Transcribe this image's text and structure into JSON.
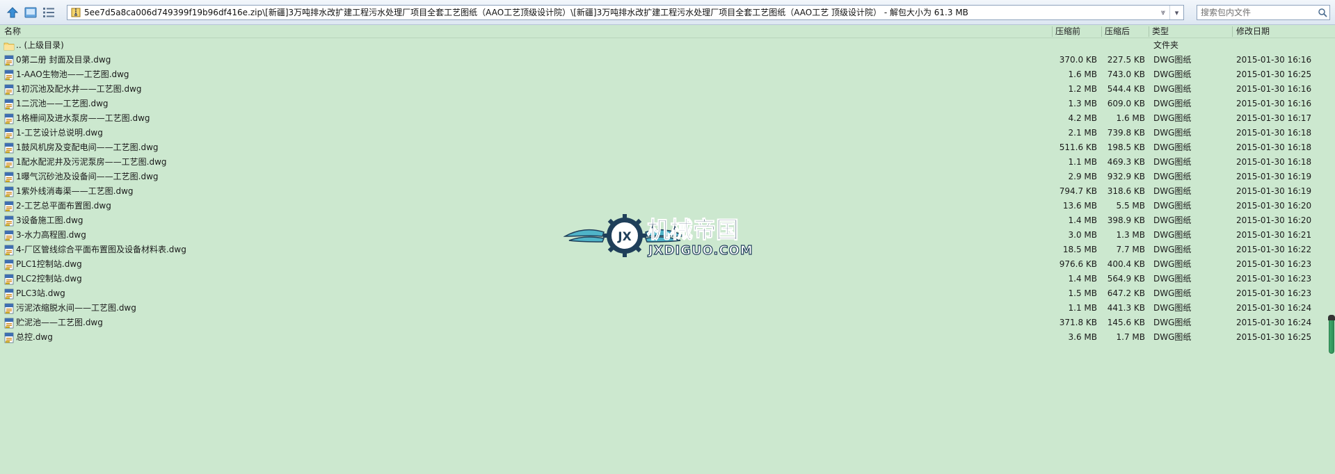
{
  "toolbar": {
    "address": "5ee7d5a8ca006d749399f19b96df416e.zip\\[新疆]3万吨排水改扩建工程污水处理厂项目全套工艺图纸（AAO工艺顶级设计院）\\[新疆]3万吨排水改扩建工程污水处理厂项目全套工艺图纸（AAO工艺 顶级设计院） - 解包大小为 61.3 MB",
    "search_placeholder": "搜索包内文件",
    "addr_history_glyph": "⩔",
    "addr_drop_glyph": "▾"
  },
  "columns": {
    "name": "名称",
    "packed": "压缩前",
    "unpacked": "压缩后",
    "type": "类型",
    "date": "修改日期"
  },
  "parent_row": {
    "name": ".. (上级目录)",
    "type": "文件夹"
  },
  "files": [
    {
      "name": "0第二册 封面及目录.dwg",
      "packed": "370.0 KB",
      "unpacked": "227.5 KB",
      "type": "DWG图纸",
      "date": "2015-01-30 16:16"
    },
    {
      "name": "1-AAO生物池——工艺图.dwg",
      "packed": "1.6 MB",
      "unpacked": "743.0 KB",
      "type": "DWG图纸",
      "date": "2015-01-30 16:25"
    },
    {
      "name": "1初沉池及配水井——工艺图.dwg",
      "packed": "1.2 MB",
      "unpacked": "544.4 KB",
      "type": "DWG图纸",
      "date": "2015-01-30 16:16"
    },
    {
      "name": "1二沉池——工艺图.dwg",
      "packed": "1.3 MB",
      "unpacked": "609.0 KB",
      "type": "DWG图纸",
      "date": "2015-01-30 16:16"
    },
    {
      "name": "1格栅间及进水泵房——工艺图.dwg",
      "packed": "4.2 MB",
      "unpacked": "1.6 MB",
      "type": "DWG图纸",
      "date": "2015-01-30 16:17"
    },
    {
      "name": "1-工艺设计总说明.dwg",
      "packed": "2.1 MB",
      "unpacked": "739.8 KB",
      "type": "DWG图纸",
      "date": "2015-01-30 16:18"
    },
    {
      "name": "1鼓风机房及变配电间——工艺图.dwg",
      "packed": "511.6 KB",
      "unpacked": "198.5 KB",
      "type": "DWG图纸",
      "date": "2015-01-30 16:18"
    },
    {
      "name": "1配水配泥井及污泥泵房——工艺图.dwg",
      "packed": "1.1 MB",
      "unpacked": "469.3 KB",
      "type": "DWG图纸",
      "date": "2015-01-30 16:18"
    },
    {
      "name": "1曝气沉砂池及设备间——工艺图.dwg",
      "packed": "2.9 MB",
      "unpacked": "932.9 KB",
      "type": "DWG图纸",
      "date": "2015-01-30 16:19"
    },
    {
      "name": "1紫外线消毒渠——工艺图.dwg",
      "packed": "794.7 KB",
      "unpacked": "318.6 KB",
      "type": "DWG图纸",
      "date": "2015-01-30 16:19"
    },
    {
      "name": "2-工艺总平面布置图.dwg",
      "packed": "13.6 MB",
      "unpacked": "5.5 MB",
      "type": "DWG图纸",
      "date": "2015-01-30 16:20"
    },
    {
      "name": "3设备施工图.dwg",
      "packed": "1.4 MB",
      "unpacked": "398.9 KB",
      "type": "DWG图纸",
      "date": "2015-01-30 16:20"
    },
    {
      "name": "3-水力高程图.dwg",
      "packed": "3.0 MB",
      "unpacked": "1.3 MB",
      "type": "DWG图纸",
      "date": "2015-01-30 16:21"
    },
    {
      "name": "4-厂区管线综合平面布置图及设备材料表.dwg",
      "packed": "18.5 MB",
      "unpacked": "7.7 MB",
      "type": "DWG图纸",
      "date": "2015-01-30 16:22"
    },
    {
      "name": "PLC1控制站.dwg",
      "packed": "976.6 KB",
      "unpacked": "400.4 KB",
      "type": "DWG图纸",
      "date": "2015-01-30 16:23"
    },
    {
      "name": "PLC2控制站.dwg",
      "packed": "1.4 MB",
      "unpacked": "564.9 KB",
      "type": "DWG图纸",
      "date": "2015-01-30 16:23"
    },
    {
      "name": "PLC3站.dwg",
      "packed": "1.5 MB",
      "unpacked": "647.2 KB",
      "type": "DWG图纸",
      "date": "2015-01-30 16:23"
    },
    {
      "name": "污泥浓缩脱水间——工艺图.dwg",
      "packed": "1.1 MB",
      "unpacked": "441.3 KB",
      "type": "DWG图纸",
      "date": "2015-01-30 16:24"
    },
    {
      "name": "贮泥池——工艺图.dwg",
      "packed": "371.8 KB",
      "unpacked": "145.6 KB",
      "type": "DWG图纸",
      "date": "2015-01-30 16:24"
    },
    {
      "name": "总控.dwg",
      "packed": "3.6 MB",
      "unpacked": "1.7 MB",
      "type": "DWG图纸",
      "date": "2015-01-30 16:25"
    }
  ],
  "watermark": {
    "cn": "机械帝国",
    "en": "JXDIGUO.COM",
    "badge": "JX"
  },
  "icons": {
    "up": "arrow-up-icon",
    "view": "view-icon",
    "details": "details-view-icon",
    "zip": "zip-icon",
    "search": "search-icon",
    "folder": "folder-icon",
    "dwg": "dwg-file-icon"
  },
  "colors": {
    "background": "#cce8cf",
    "toolbar": "#dde7f2",
    "accent": "#3b8fd6",
    "watermark_dark": "#1f3f5a",
    "watermark_teal": "#4fb3c8"
  }
}
